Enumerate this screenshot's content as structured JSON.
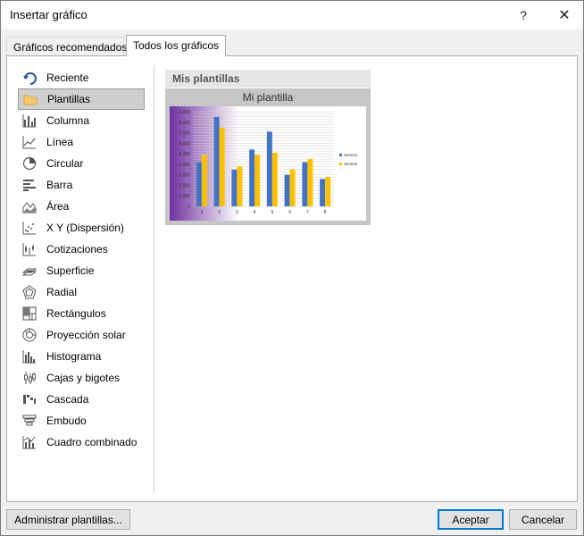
{
  "window": {
    "title": "Insertar gráfico",
    "help_label": "?",
    "close_label": "✕"
  },
  "tabs": [
    {
      "label": "Gráficos recomendados",
      "active": false
    },
    {
      "label": "Todos los gráficos",
      "active": true
    }
  ],
  "chart_types": [
    {
      "label": "Reciente",
      "icon": "recent-icon",
      "selected": false
    },
    {
      "label": "Plantillas",
      "icon": "folder-icon",
      "selected": true
    },
    {
      "label": "Columna",
      "icon": "column-chart-icon",
      "selected": false
    },
    {
      "label": "Línea",
      "icon": "line-chart-icon",
      "selected": false
    },
    {
      "label": "Circular",
      "icon": "pie-chart-icon",
      "selected": false
    },
    {
      "label": "Barra",
      "icon": "bar-chart-icon",
      "selected": false
    },
    {
      "label": "Área",
      "icon": "area-chart-icon",
      "selected": false
    },
    {
      "label": "X Y (Dispersión)",
      "icon": "scatter-chart-icon",
      "selected": false
    },
    {
      "label": "Cotizaciones",
      "icon": "stock-chart-icon",
      "selected": false
    },
    {
      "label": "Superficie",
      "icon": "surface-chart-icon",
      "selected": false
    },
    {
      "label": "Radial",
      "icon": "radar-chart-icon",
      "selected": false
    },
    {
      "label": "Rectángulos",
      "icon": "treemap-chart-icon",
      "selected": false
    },
    {
      "label": "Proyección solar",
      "icon": "sunburst-chart-icon",
      "selected": false
    },
    {
      "label": "Histograma",
      "icon": "histogram-chart-icon",
      "selected": false
    },
    {
      "label": "Cajas y bigotes",
      "icon": "box-whisker-chart-icon",
      "selected": false
    },
    {
      "label": "Cascada",
      "icon": "waterfall-chart-icon",
      "selected": false
    },
    {
      "label": "Embudo",
      "icon": "funnel-chart-icon",
      "selected": false
    },
    {
      "label": "Cuadro combinado",
      "icon": "combo-chart-icon",
      "selected": false
    }
  ],
  "templates": {
    "section_title": "Mis plantillas",
    "items": [
      {
        "name": "Mi plantilla"
      }
    ]
  },
  "chart_data": {
    "type": "bar",
    "categories": [
      "1",
      "2",
      "3",
      "4",
      "5",
      "6",
      "7",
      "8"
    ],
    "series": [
      {
        "name": "Series1",
        "color": "#4472c4",
        "values": [
          4200,
          8500,
          3500,
          5400,
          7100,
          3000,
          4200,
          2600
        ]
      },
      {
        "name": "Series2",
        "color": "#ffc000",
        "values": [
          4900,
          7500,
          3800,
          4900,
          5100,
          3500,
          4500,
          2800
        ]
      }
    ],
    "y_ticks": [
      "0",
      "1.000",
      "2.000",
      "3.000",
      "4.000",
      "5.000",
      "6.000",
      "7.000",
      "8.000",
      "9.000"
    ],
    "ylim": [
      0,
      9000
    ],
    "legend": "right",
    "plot_bg_gradient": [
      "#7030a0",
      "#ffffff"
    ]
  },
  "buttons": {
    "manage": "Administrar plantillas...",
    "ok": "Aceptar",
    "cancel": "Cancelar"
  }
}
